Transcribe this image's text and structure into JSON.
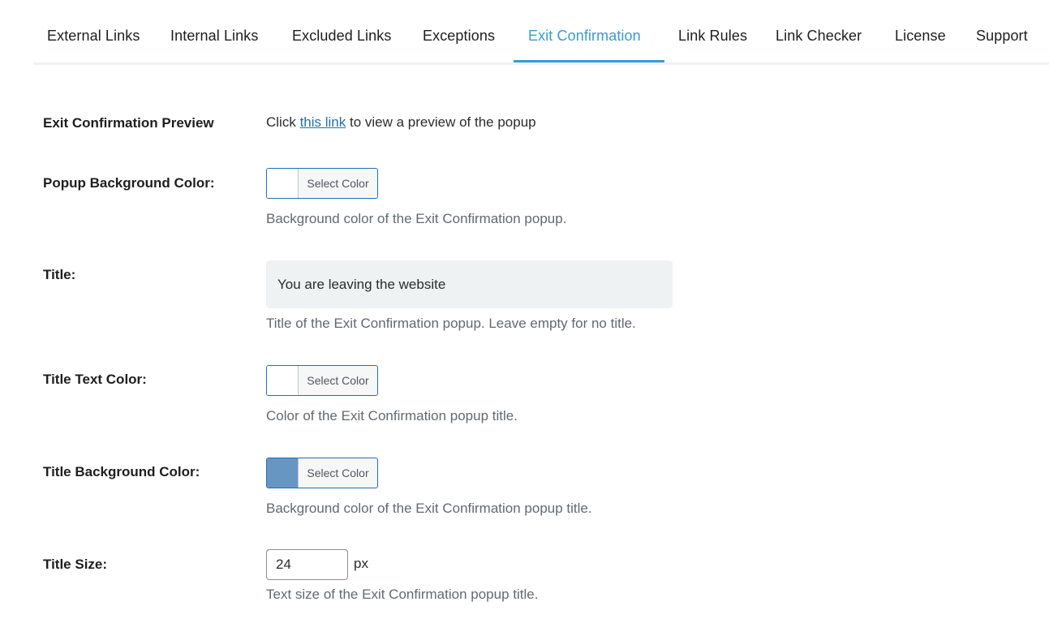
{
  "tabs": [
    {
      "label": "External Links"
    },
    {
      "label": "Internal Links"
    },
    {
      "label": "Excluded Links"
    },
    {
      "label": "Exceptions"
    },
    {
      "label": "Exit Confirmation",
      "active": true
    },
    {
      "label": "Link Rules"
    },
    {
      "label": "Link Checker"
    },
    {
      "label": "License"
    },
    {
      "label": "Support"
    }
  ],
  "accent_color": "#3b9ad1",
  "preview": {
    "label": "Exit Confirmation Preview",
    "text_before": "Click ",
    "link_text": "this link",
    "text_after": " to view a preview of the popup"
  },
  "popup_bg": {
    "label": "Popup Background Color:",
    "button_label": "Select Color",
    "swatch_color": "#ffffff",
    "description": "Background color of the Exit Confirmation popup."
  },
  "title": {
    "label": "Title:",
    "value": "You are leaving the website",
    "description": "Title of the Exit Confirmation popup. Leave empty for no title."
  },
  "title_text_color": {
    "label": "Title Text Color:",
    "button_label": "Select Color",
    "swatch_color": "#ffffff",
    "description": "Color of the Exit Confirmation popup title."
  },
  "title_bg_color": {
    "label": "Title Background Color:",
    "button_label": "Select Color",
    "swatch_color": "#6896c3",
    "description": "Background color of the Exit Confirmation popup title."
  },
  "title_size": {
    "label": "Title Size:",
    "value": "24",
    "unit": "px",
    "description": "Text size of the Exit Confirmation popup title."
  }
}
